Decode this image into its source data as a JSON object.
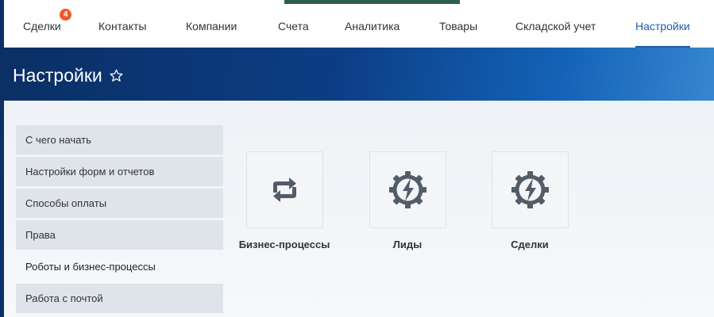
{
  "nav": {
    "items": [
      {
        "label": "Сделки",
        "badge": "4"
      },
      {
        "label": "Контакты"
      },
      {
        "label": "Компании"
      },
      {
        "label": "Счета"
      },
      {
        "label": "Аналитика"
      },
      {
        "label": "Товары"
      },
      {
        "label": "Складской учет"
      },
      {
        "label": "Настройки",
        "active": true
      }
    ]
  },
  "header": {
    "title": "Настройки"
  },
  "sidebar": {
    "items": [
      {
        "label": "С чего начать"
      },
      {
        "label": "Настройки форм и отчетов"
      },
      {
        "label": "Способы оплаты"
      },
      {
        "label": "Права"
      },
      {
        "label": "Роботы и бизнес-процессы",
        "active": true
      },
      {
        "label": "Работа с почтой"
      }
    ]
  },
  "tiles": [
    {
      "label": "Бизнес-процессы",
      "icon": "refresh-icon"
    },
    {
      "label": "Лиды",
      "icon": "gear-lightning-icon"
    },
    {
      "label": "Сделки",
      "icon": "gear-lightning-icon"
    }
  ],
  "colors": {
    "accent": "#1e5ea8",
    "badge": "#f05a28",
    "icon": "#535c69"
  }
}
